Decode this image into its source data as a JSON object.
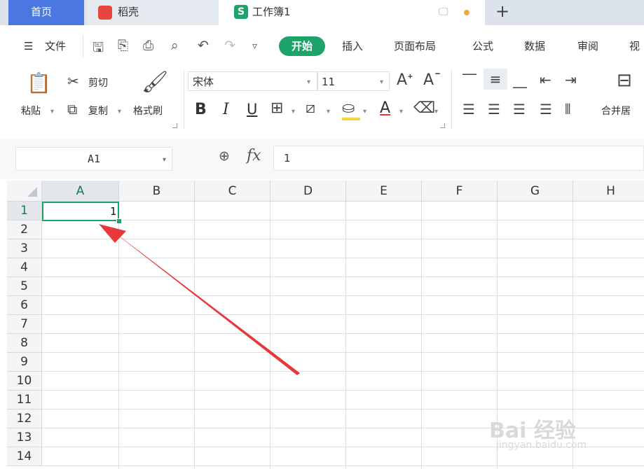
{
  "tabs": {
    "home": "首页",
    "daoke": "稻壳",
    "workbook": "工作簿1",
    "workbook_logo": "S",
    "add": "+"
  },
  "menu": {
    "hamburger": "☰",
    "file": "文件",
    "items": [
      "开始",
      "插入",
      "页面布局",
      "公式",
      "数据",
      "审阅",
      "视"
    ]
  },
  "ribbon": {
    "paste": "粘贴",
    "cut": "剪切",
    "copy": "复制",
    "format_painter": "格式刷",
    "font_name": "宋体",
    "font_size": "11",
    "bold": "B",
    "italic": "I",
    "underline": "U",
    "font_color_letter": "A",
    "merge_center": "合并居"
  },
  "formula_bar": {
    "name_box": "A1",
    "fx": "fx",
    "value": "1"
  },
  "sheet": {
    "columns": [
      "A",
      "B",
      "C",
      "D",
      "E",
      "F",
      "G",
      "H"
    ],
    "rows": [
      "1",
      "2",
      "3",
      "4",
      "5",
      "6",
      "7",
      "8",
      "9",
      "10",
      "11",
      "12",
      "13",
      "14"
    ],
    "selected_cell": "A1",
    "a1_value": "1"
  },
  "watermark": {
    "text": "Bai 经验",
    "url": "jingyan.baidu.com"
  },
  "colors": {
    "accent_green": "#1ea36b",
    "home_tab_blue": "#4a78e0",
    "arrow_red": "#e8383b"
  }
}
